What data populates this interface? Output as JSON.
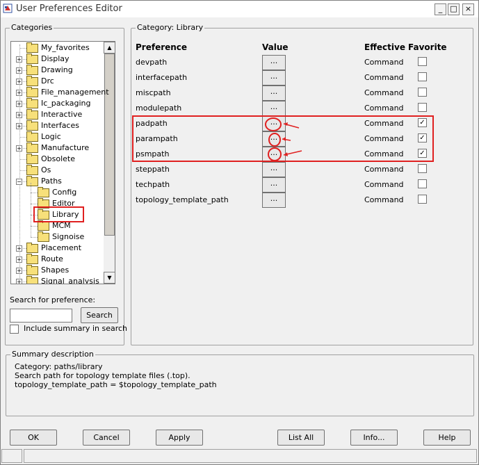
{
  "window": {
    "title": "User Preferences Editor",
    "buttons": [
      "_",
      "□",
      "×"
    ]
  },
  "categories": {
    "label": "Categories",
    "items": [
      {
        "label": "My_favorites",
        "expandable": false,
        "level": 0
      },
      {
        "label": "Display",
        "expandable": true,
        "level": 0
      },
      {
        "label": "Drawing",
        "expandable": true,
        "level": 0
      },
      {
        "label": "Drc",
        "expandable": true,
        "level": 0
      },
      {
        "label": "File_management",
        "expandable": true,
        "level": 0
      },
      {
        "label": "Ic_packaging",
        "expandable": true,
        "level": 0
      },
      {
        "label": "Interactive",
        "expandable": true,
        "level": 0
      },
      {
        "label": "Interfaces",
        "expandable": true,
        "level": 0
      },
      {
        "label": "Logic",
        "expandable": false,
        "level": 0
      },
      {
        "label": "Manufacture",
        "expandable": true,
        "level": 0
      },
      {
        "label": "Obsolete",
        "expandable": false,
        "level": 0
      },
      {
        "label": "Os",
        "expandable": false,
        "level": 0
      },
      {
        "label": "Paths",
        "expandable": true,
        "expanded": true,
        "level": 0
      },
      {
        "label": "Config",
        "expandable": false,
        "level": 1
      },
      {
        "label": "Editor",
        "expandable": false,
        "level": 1
      },
      {
        "label": "Library",
        "expandable": false,
        "level": 1,
        "selected": true
      },
      {
        "label": "MCM",
        "expandable": false,
        "level": 1
      },
      {
        "label": "Signoise",
        "expandable": false,
        "level": 1
      },
      {
        "label": "Placement",
        "expandable": true,
        "level": 0
      },
      {
        "label": "Route",
        "expandable": true,
        "level": 0
      },
      {
        "label": "Shapes",
        "expandable": true,
        "level": 0
      },
      {
        "label": "Signal_analysis",
        "expandable": true,
        "level": 0
      }
    ]
  },
  "search": {
    "label": "Search for preference:",
    "value": "",
    "button": "Search",
    "include_summary": "Include summary in search",
    "include_checked": false
  },
  "prefs": {
    "category_label": "Category:  Library",
    "headers": {
      "preference": "Preference",
      "value": "Value",
      "effective": "Effective",
      "favorite": "Favorite"
    },
    "rows": [
      {
        "name": "devpath",
        "value": "...",
        "effective": "Command",
        "favorite": false
      },
      {
        "name": "interfacepath",
        "value": "...",
        "effective": "Command",
        "favorite": false
      },
      {
        "name": "miscpath",
        "value": "...",
        "effective": "Command",
        "favorite": false
      },
      {
        "name": "modulepath",
        "value": "...",
        "effective": "Command",
        "favorite": false
      },
      {
        "name": "padpath",
        "value": "...",
        "effective": "Command",
        "favorite": true
      },
      {
        "name": "parampath",
        "value": "...",
        "effective": "Command",
        "favorite": true
      },
      {
        "name": "psmpath",
        "value": "...",
        "effective": "Command",
        "favorite": true
      },
      {
        "name": "steppath",
        "value": "...",
        "effective": "Command",
        "favorite": false
      },
      {
        "name": "techpath",
        "value": "...",
        "effective": "Command",
        "favorite": false
      },
      {
        "name": "topology_template_path",
        "value": "...",
        "effective": "Command",
        "favorite": false
      }
    ]
  },
  "summary": {
    "label": "Summary description",
    "lines": [
      "Category: paths/library",
      "Search path for topology template files (.top).",
      "topology_template_path = $topology_template_path"
    ]
  },
  "buttons": {
    "ok": "OK",
    "cancel": "Cancel",
    "apply": "Apply",
    "list_all": "List All",
    "info": "Info...",
    "help": "Help"
  },
  "colors": {
    "annotation": "#e02020",
    "folder": "#f7e07a"
  }
}
